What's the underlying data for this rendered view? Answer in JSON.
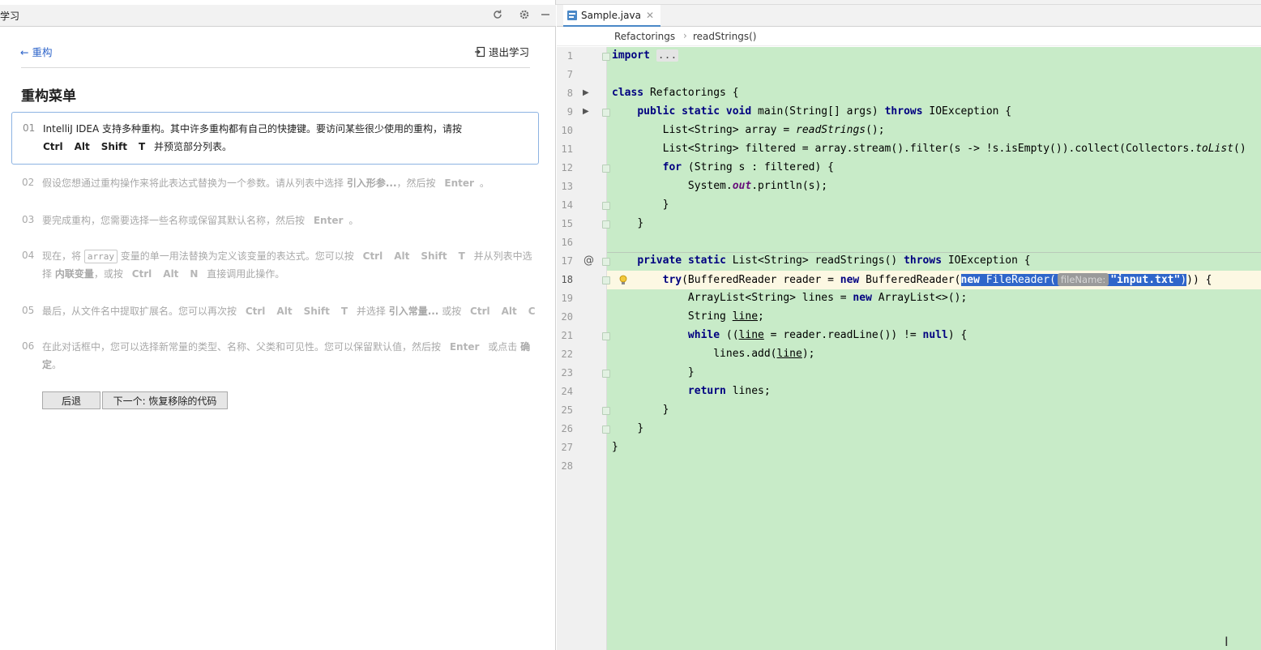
{
  "learn": {
    "panel_title": "学习",
    "back_label": "← 重构",
    "exit_label": "退出学习",
    "lesson_title": "重构菜单",
    "steps": [
      {
        "num": "01",
        "text_a": "IntelliJ IDEA 支持多种重构。其中许多重构都有自己的快捷键。要访问某些很少使用的重构，请按",
        "keys": [
          "Ctrl",
          "Alt",
          "Shift",
          "T"
        ],
        "text_b": "并预览部分列表。"
      },
      {
        "num": "02",
        "text_a": "假设您想通过重构操作来将此表达式替换为一个参数。请从列表中选择",
        "term": "引入形参...",
        "text_b": "，然后按",
        "key": "Enter",
        "text_c": "。"
      },
      {
        "num": "03",
        "text_a": "要完成重构，您需要选择一些名称或保留其默认名称，然后按",
        "key": "Enter",
        "text_b": "。"
      },
      {
        "num": "04",
        "text_a": "现在，将",
        "chip": "array",
        "text_b": "变量的单一用法替换为定义该变量的表达式。您可以按",
        "keys": [
          "Ctrl",
          "Alt",
          "Shift",
          "T"
        ],
        "text_c": "并从列表中选择",
        "term": "内联变量",
        "text_d": "，或按",
        "keys2": [
          "Ctrl",
          "Alt",
          "N"
        ],
        "text_e": "直接调用此操作。"
      },
      {
        "num": "05",
        "text_a": "最后，从文件名中提取扩展名。您可以再次按",
        "keys": [
          "Ctrl",
          "Alt",
          "Shift",
          "T"
        ],
        "text_b": "并选择",
        "term": "引入常量...",
        "text_c": "或按",
        "keys2": [
          "Ctrl",
          "Alt",
          "C"
        ]
      },
      {
        "num": "06",
        "text_a": "在此对话框中，您可以选择新常量的类型、名称、父类和可见性。您可以保留默认值，然后按",
        "key": "Enter",
        "text_b": "或点击",
        "term": "确定",
        "text_c": "。"
      }
    ],
    "back_button": "后退",
    "next_button": "下一个: 恢复移除的代码"
  },
  "editor": {
    "tab_label": "Sample.java",
    "breadcrumb": [
      "Refactorings",
      "readStrings()"
    ],
    "breadcrumb_sep": "›",
    "line_numbers": [
      "1",
      "7",
      "8",
      "9",
      "10",
      "11",
      "12",
      "13",
      "14",
      "15",
      "16",
      "17",
      "18",
      "19",
      "20",
      "21",
      "22",
      "23",
      "24",
      "25",
      "26",
      "27",
      "28"
    ],
    "code": {
      "l1_kw": "import",
      "l1_fold": "...",
      "l8_kw": "class",
      "l8_rest": " Refactorings {",
      "l9_kw1": "public",
      "l9_kw2": "static",
      "l9_kw3": "void",
      "l9_mid": " main(String[] args) ",
      "l9_kw4": "throws",
      "l9_end": " IOException {",
      "l10_a": "List<String> array = ",
      "l10_it": "readStrings",
      "l10_b": "();",
      "l11_a": "List<String> filtered = array.stream().filter(s -> !s.isEmpty()).collect(Collectors.",
      "l11_it": "toList",
      "l11_b": "()",
      "l12_kw": "for",
      "l12_rest": " (String s : filtered) {",
      "l13_a": "System.",
      "l13_it": "out",
      "l13_b": ".println(s);",
      "l14": "}",
      "l15": "}",
      "l17_kw1": "private",
      "l17_kw2": "static",
      "l17_mid": " List<String> readStrings() ",
      "l17_kw3": "throws",
      "l17_end": " IOException {",
      "l18_kw": "try",
      "l18_a": "(BufferedReader reader = ",
      "l18_kw2": "new",
      "l18_b": " BufferedReader(",
      "l18_sel_kw": "new",
      "l18_sel_a": " FileReader(",
      "l18_hint": "fileName:",
      "l18_str": "\"input.txt\"",
      "l18_sel_b": ")",
      "l18_end": ")) {",
      "l19_a": "ArrayList<String> lines = ",
      "l19_kw": "new",
      "l19_b": " ArrayList<>();",
      "l20_a": "String ",
      "l20_u": "line",
      "l20_b": ";",
      "l21_kw": "while",
      "l21_a": " ((",
      "l21_u": "line",
      "l21_b": " = reader.readLine()) != ",
      "l21_kw2": "null",
      "l21_c": ") {",
      "l22_a": "lines.add(",
      "l22_u": "line",
      "l22_b": ");",
      "l23": "}",
      "l24_kw": "return",
      "l24_rest": " lines;",
      "l25": "}",
      "l26": "}",
      "l27": "}"
    }
  },
  "colors": {
    "accent": "#2f65ca",
    "code_bg": "#c8ebc8",
    "current_line": "#fcf8e3",
    "keyword": "#000080"
  }
}
